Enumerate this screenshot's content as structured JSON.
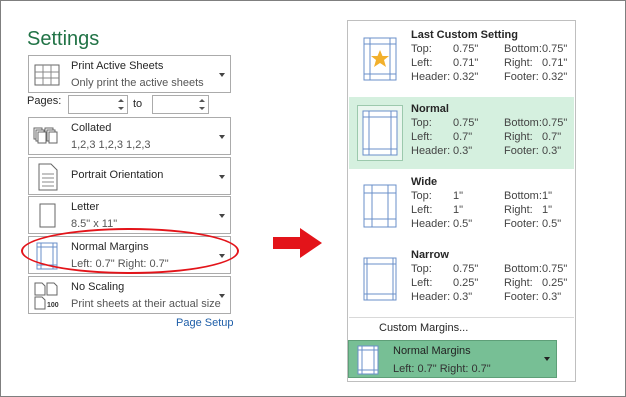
{
  "left": {
    "title": "Settings",
    "print_what": {
      "label": "Print Active Sheets",
      "desc": "Only print the active sheets"
    },
    "pages": {
      "label": "Pages:",
      "to": "to",
      "from_value": "",
      "to_value": ""
    },
    "collation": {
      "label": "Collated",
      "desc": "1,2,3    1,2,3    1,2,3"
    },
    "orientation": {
      "label": "Portrait Orientation"
    },
    "paper": {
      "label": "Letter",
      "desc": "8.5\" x 11\""
    },
    "margins": {
      "label": "Normal Margins",
      "desc": "Left:  0.7\"    Right:  0.7\""
    },
    "scaling": {
      "label": "No Scaling",
      "desc": "Print sheets at their actual size",
      "icon_text": "100"
    },
    "page_setup_link": "Page Setup"
  },
  "menu": {
    "options": [
      {
        "title": "Last Custom Setting",
        "selected": false,
        "top": "0.75\"",
        "bottom": "0.75\"",
        "left": "0.71\"",
        "right": "0.71\"",
        "header": "0.32\"",
        "footer": "0.32\""
      },
      {
        "title": "Normal",
        "selected": true,
        "top": "0.75\"",
        "bottom": "0.75\"",
        "left": "0.7\"",
        "right": "0.7\"",
        "header": "0.3\"",
        "footer": "0.3\""
      },
      {
        "title": "Wide",
        "selected": false,
        "top": "1\"",
        "bottom": "1\"",
        "left": "1\"",
        "right": "1\"",
        "header": "0.5\"",
        "footer": "0.5\""
      },
      {
        "title": "Narrow",
        "selected": false,
        "top": "0.75\"",
        "bottom": "0.75\"",
        "left": "0.25\"",
        "right": "0.25\"",
        "header": "0.3\"",
        "footer": "0.3\""
      }
    ],
    "labels": {
      "top": "Top:",
      "bottom": "Bottom:",
      "left": "Left:",
      "right": "Right:",
      "header": "Header:",
      "footer": "Footer:"
    },
    "custom_margins": "Custom Margins..."
  },
  "bottom_dropdown": {
    "label": "Normal Margins",
    "desc": "Left:  0.7\"    Right:  0.7\""
  },
  "colors": {
    "accent": "#217346",
    "selected_bg": "#d5f0df",
    "highlight": "#77bf95",
    "annotation": "#e3141a"
  }
}
